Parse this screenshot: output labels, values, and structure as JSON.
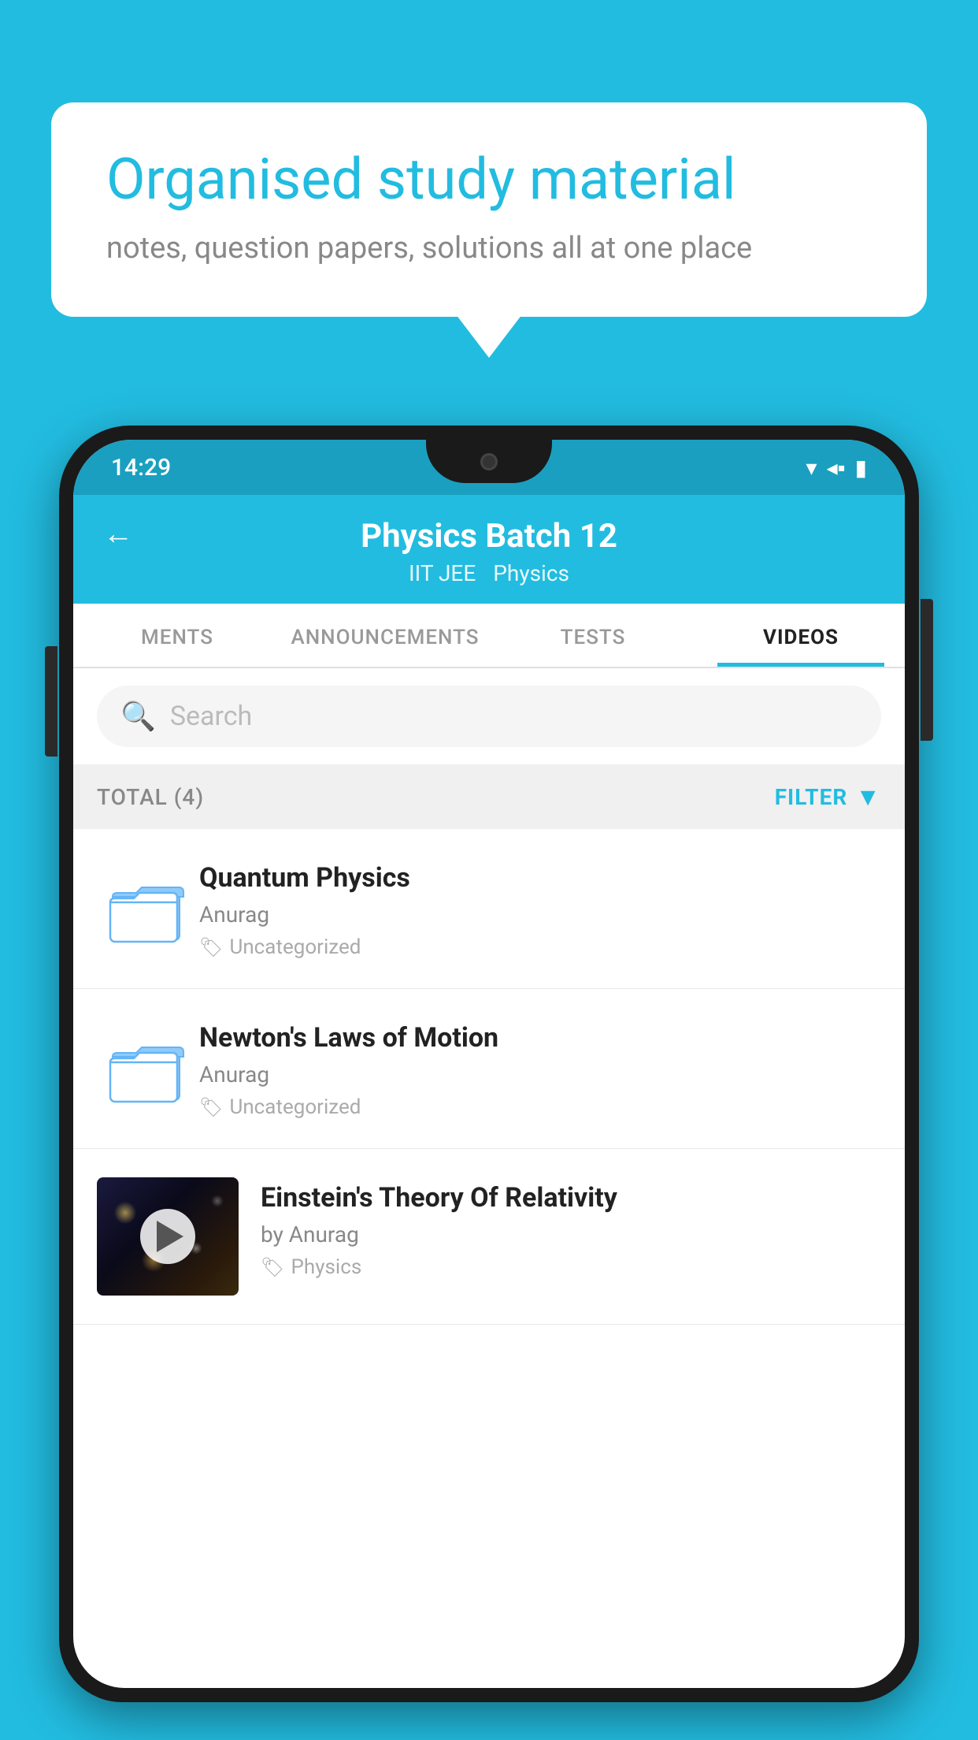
{
  "bubble": {
    "title": "Organised study material",
    "subtitle": "notes, question papers, solutions all at one place"
  },
  "statusBar": {
    "time": "14:29"
  },
  "header": {
    "title": "Physics Batch 12",
    "subtitle1": "IIT JEE",
    "subtitle2": "Physics",
    "backLabel": "←"
  },
  "tabs": [
    {
      "label": "MENTS",
      "active": false
    },
    {
      "label": "ANNOUNCEMENTS",
      "active": false
    },
    {
      "label": "TESTS",
      "active": false
    },
    {
      "label": "VIDEOS",
      "active": true
    }
  ],
  "search": {
    "placeholder": "Search"
  },
  "filterBar": {
    "total": "TOTAL (4)",
    "filter": "FILTER"
  },
  "videos": [
    {
      "title": "Quantum Physics",
      "author": "Anurag",
      "tag": "Uncategorized",
      "type": "folder"
    },
    {
      "title": "Newton's Laws of Motion",
      "author": "Anurag",
      "tag": "Uncategorized",
      "type": "folder"
    },
    {
      "title": "Einstein's Theory Of Relativity",
      "author": "by Anurag",
      "tag": "Physics",
      "type": "video"
    }
  ]
}
